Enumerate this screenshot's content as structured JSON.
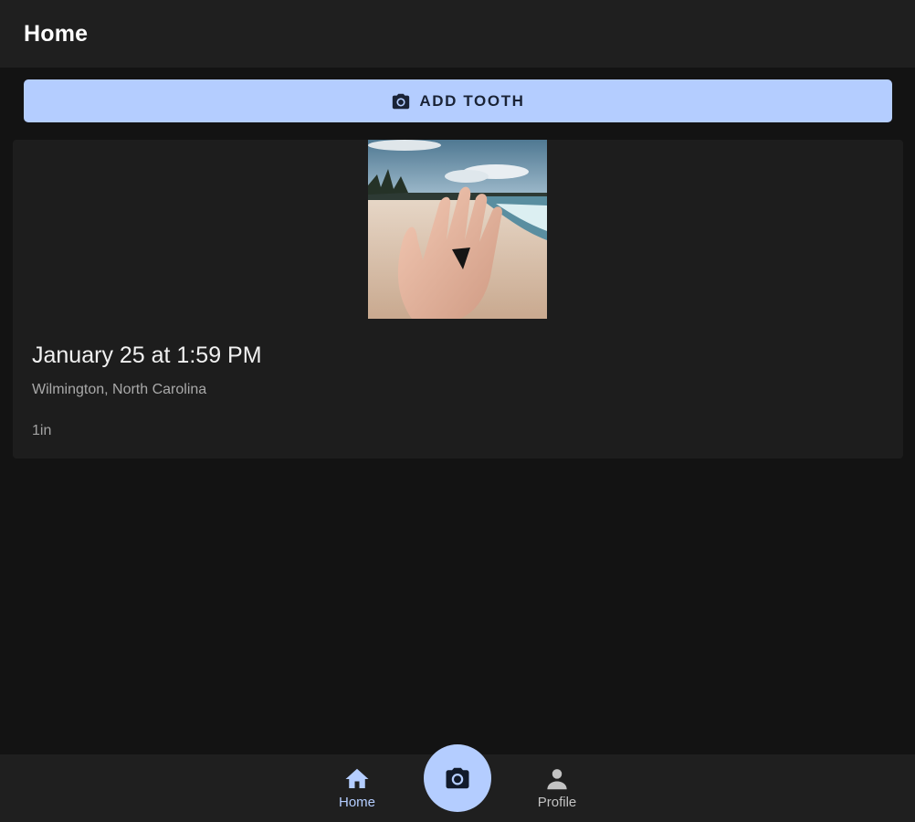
{
  "header": {
    "title": "Home"
  },
  "add_button": {
    "label": "ADD TOOTH",
    "icon": "camera-icon"
  },
  "entries": [
    {
      "image": "shark tooth in palm on beach photo",
      "date": "January 25 at 1:59 PM",
      "location": "Wilmington, North Carolina",
      "size": "1in"
    }
  ],
  "bottom_nav": {
    "items": [
      {
        "label": "Home",
        "icon": "home-icon",
        "active": true
      },
      {
        "label": "Profile",
        "icon": "person-icon",
        "active": false
      }
    ],
    "fab_icon": "camera-icon"
  },
  "colors": {
    "background": "#131313",
    "surface": "#1f1f1f",
    "card": "#1d1d1d",
    "accent": "#b4cdff"
  }
}
